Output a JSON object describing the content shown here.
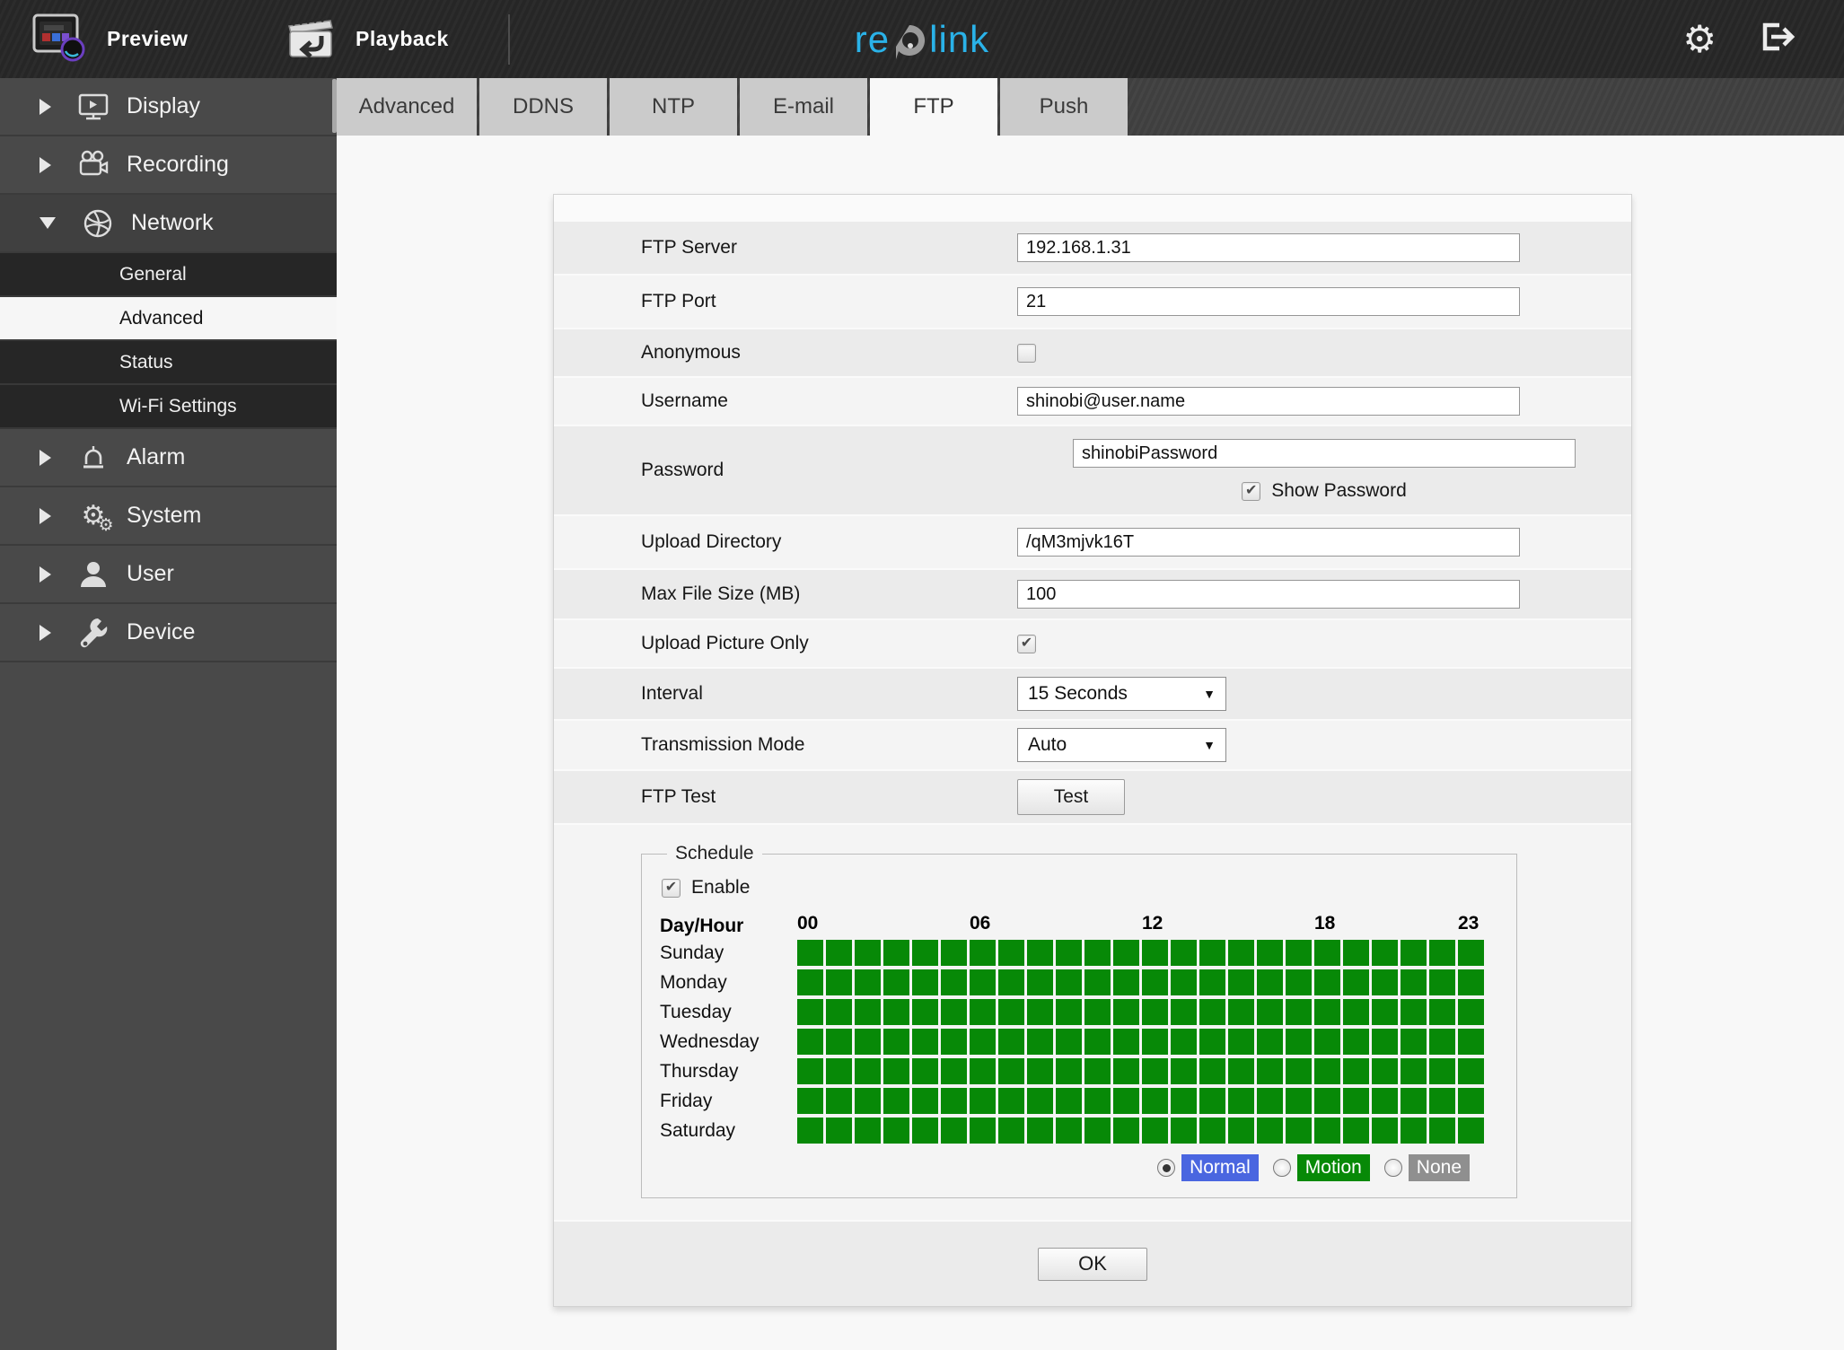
{
  "topbar": {
    "preview_label": "Preview",
    "playback_label": "Playback",
    "logo_re": "re",
    "logo_link": "link",
    "logo_color": "#2ab2e8"
  },
  "tabs": {
    "items": [
      "Advanced",
      "DDNS",
      "NTP",
      "E-mail",
      "FTP",
      "Push"
    ],
    "active": "FTP"
  },
  "sidebar": {
    "items": [
      {
        "label": "Display",
        "icon": "monitor-icon",
        "state": "collapsed"
      },
      {
        "label": "Recording",
        "icon": "video-camera-icon",
        "state": "collapsed"
      },
      {
        "label": "Network",
        "icon": "globe-icon",
        "state": "expanded",
        "children": [
          {
            "label": "General",
            "active": false
          },
          {
            "label": "Advanced",
            "active": true
          },
          {
            "label": "Status",
            "active": false
          },
          {
            "label": "Wi-Fi Settings",
            "active": false
          }
        ]
      },
      {
        "label": "Alarm",
        "icon": "alarm-icon",
        "state": "collapsed"
      },
      {
        "label": "System",
        "icon": "gears-icon",
        "state": "collapsed"
      },
      {
        "label": "User",
        "icon": "user-icon",
        "state": "collapsed"
      },
      {
        "label": "Device",
        "icon": "wrench-icon",
        "state": "collapsed"
      }
    ]
  },
  "form": {
    "ftp_server": {
      "label": "FTP Server",
      "value": "192.168.1.31"
    },
    "ftp_port": {
      "label": "FTP Port",
      "value": "21"
    },
    "anonymous": {
      "label": "Anonymous",
      "checked": false
    },
    "username": {
      "label": "Username",
      "value": "shinobi@user.name"
    },
    "password": {
      "label": "Password",
      "value": "shinobiPassword",
      "show_password_label": "Show Password",
      "show_password_checked": true
    },
    "upload_directory": {
      "label": "Upload Directory",
      "value": "/qM3mjvk16T"
    },
    "max_file_size": {
      "label": "Max File Size (MB)",
      "value": "100"
    },
    "upload_picture": {
      "label": "Upload Picture Only",
      "checked": true
    },
    "interval": {
      "label": "Interval",
      "value": "15 Seconds"
    },
    "transmission": {
      "label": "Transmission Mode",
      "value": "Auto"
    },
    "ftp_test": {
      "label": "FTP Test",
      "button_label": "Test"
    }
  },
  "schedule": {
    "legend": "Schedule",
    "enable_label": "Enable",
    "enable_checked": true,
    "corner_label": "Day/Hour",
    "hour_labels": [
      "00",
      "06",
      "12",
      "18",
      "23"
    ],
    "hour_columns": [
      0,
      6,
      12,
      18,
      23
    ],
    "columns": 24,
    "days": [
      "Sunday",
      "Monday",
      "Tuesday",
      "Wednesday",
      "Thursday",
      "Friday",
      "Saturday"
    ],
    "all_cells_state": "motion",
    "modes": [
      {
        "label": "Normal",
        "color": "#4a66e0",
        "selected": true
      },
      {
        "label": "Motion",
        "color": "#078907",
        "selected": false
      },
      {
        "label": "None",
        "color": "#8f8f8f",
        "selected": false
      }
    ],
    "cell_color": "#078907"
  },
  "footer": {
    "ok_label": "OK"
  }
}
